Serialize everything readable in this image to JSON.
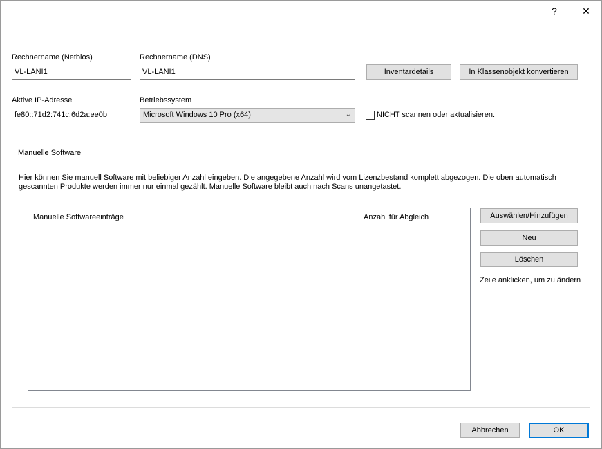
{
  "titlebar": {
    "help_label": "?",
    "close_label": "✕"
  },
  "fields": {
    "netbios_label": "Rechnername (Netbios)",
    "netbios_value": "VL-LANI1",
    "dns_label": "Rechnername (DNS)",
    "dns_value": "VL-LANI1",
    "ip_label": "Aktive IP-Adresse",
    "ip_value": "fe80::71d2:741c:6d2a:ee0b",
    "os_label": "Betriebssystem",
    "os_value": "Microsoft Windows 10 Pro (x64)"
  },
  "buttons": {
    "inventory": "Inventardetails",
    "convert": "In Klassenobjekt konvertieren",
    "select_add": "Auswählen/Hinzufügen",
    "new": "Neu",
    "delete": "Löschen",
    "cancel": "Abbrechen",
    "ok": "OK"
  },
  "checkbox": {
    "no_scan_label": "NICHT scannen oder aktualisieren.",
    "no_scan_checked": false
  },
  "manual_software": {
    "group_title": "Manuelle Software",
    "description_line1": "Hier können Sie manuell Software mit beliebiger Anzahl eingeben. Die angegebene Anzahl wird vom Lizenzbestand komplett abgezogen. Die oben automatisch",
    "description_line2": "gescannten Produkte werden immer nur einmal gezählt. Manuelle Software bleibt auch nach Scans unangetastet.",
    "columns": [
      "Manuelle Softwareeinträge",
      "Anzahl für Abgleich"
    ],
    "rows": [],
    "hint": "Zeile anklicken, um zu ändern"
  }
}
